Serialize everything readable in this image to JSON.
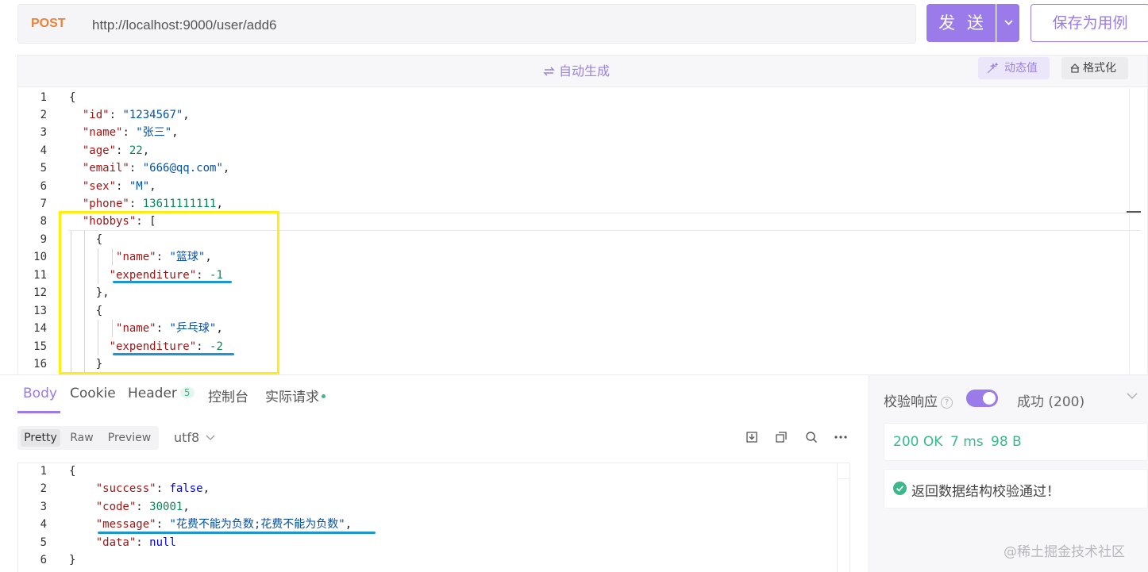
{
  "request": {
    "method": "POST",
    "url": "http://localhost:9000/user/add6",
    "send_label": "发 送",
    "save_label": "保存为用例"
  },
  "editor_toolbar": {
    "auto_generate": "自动生成",
    "dynamic_value": "动态值",
    "format": "格式化"
  },
  "request_body": {
    "line_numbers": [
      "1",
      "2",
      "3",
      "4",
      "5",
      "6",
      "7",
      "8",
      "9",
      "10",
      "11",
      "12",
      "13",
      "14",
      "15",
      "16"
    ],
    "fields": {
      "id": "\"1234567\"",
      "name": "\"张三\"",
      "age": "22",
      "email": "\"666@qq.com\"",
      "sex": "\"M\"",
      "phone": "13611111111",
      "hobby1_name": "\"篮球\"",
      "hobby1_expenditure": "-1",
      "hobby2_name": "\"乒乓球\"",
      "hobby2_expenditure": "-2"
    },
    "keys": {
      "id": "\"id\"",
      "name": "\"name\"",
      "age": "\"age\"",
      "email": "\"email\"",
      "sex": "\"sex\"",
      "phone": "\"phone\"",
      "hobbys": "\"hobbys\"",
      "expenditure": "\"expenditure\""
    }
  },
  "response_tabs": {
    "body": "Body",
    "cookie": "Cookie",
    "header": "Header",
    "header_count": "5",
    "console": "控制台",
    "actual_request": "实际请求"
  },
  "view_modes": {
    "pretty": "Pretty",
    "raw": "Raw",
    "preview": "Preview",
    "encoding": "utf8"
  },
  "response_body": {
    "line_numbers": [
      "1",
      "2",
      "3",
      "4",
      "5",
      "6"
    ],
    "keys": {
      "success": "\"success\"",
      "code": "\"code\"",
      "message": "\"message\"",
      "data": "\"data\""
    },
    "values": {
      "success": "false",
      "code": "30001",
      "message": "\"花费不能为负数;花费不能为负数\"",
      "data": "null"
    }
  },
  "validation": {
    "label": "校验响应",
    "help": "?",
    "enabled": true,
    "selected": "成功 (200)",
    "status": "200 OK",
    "time": "7 ms",
    "size": "98 B",
    "result": "返回数据结构校验通过！"
  },
  "watermark": "@稀土掘金技术社区",
  "colors": {
    "accent": "#9b7bea",
    "method": "#e8833a",
    "success": "#39b98a",
    "highlight_box": "#ffee10",
    "underline": "#1c95d3"
  }
}
